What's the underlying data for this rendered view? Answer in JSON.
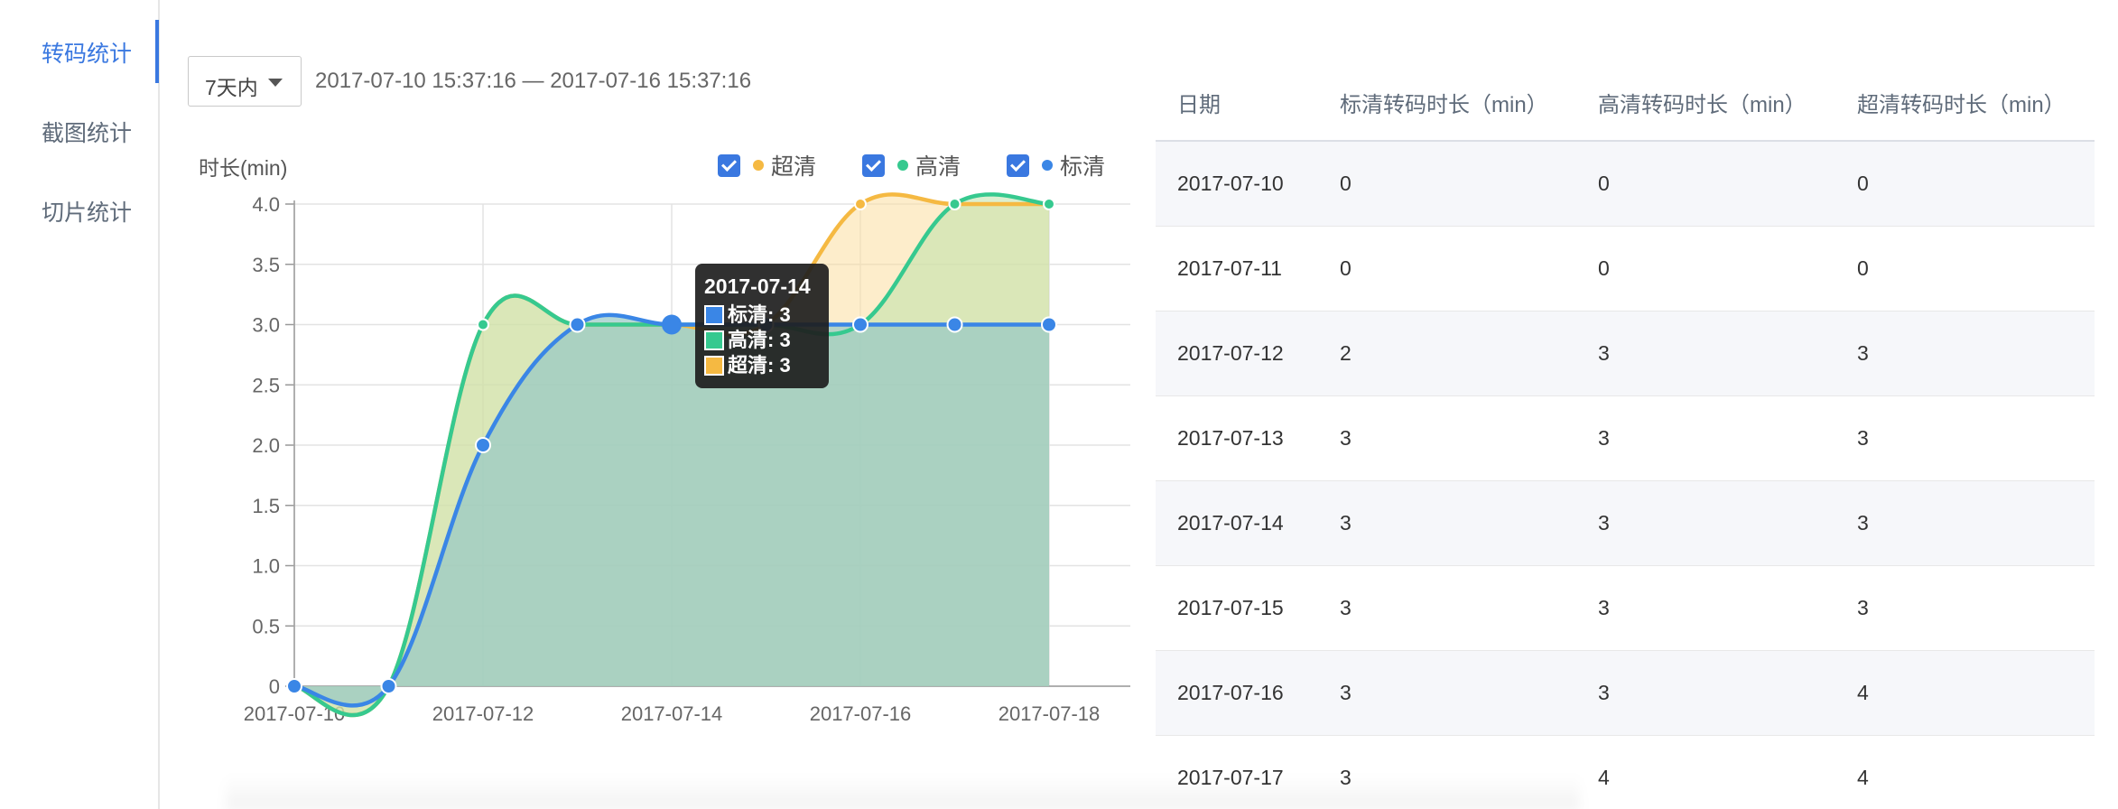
{
  "sidebar": {
    "items": [
      {
        "label": "转码统计",
        "active": true
      },
      {
        "label": "截图统计",
        "active": false
      },
      {
        "label": "切片统计",
        "active": false
      }
    ]
  },
  "toolbar": {
    "range_select": "7天内",
    "date_range": "2017-07-10 15:37:16 — 2017-07-16 15:37:16"
  },
  "legend": {
    "items": [
      {
        "label": "超清",
        "color": "#f5b942",
        "checked": true
      },
      {
        "label": "高清",
        "color": "#36c98f",
        "checked": true
      },
      {
        "label": "标清",
        "color": "#3a86e6",
        "checked": true
      }
    ]
  },
  "tooltip": {
    "title": "2017-07-14",
    "rows": [
      {
        "label": "标清: 3",
        "color": "#3a86e6"
      },
      {
        "label": "高清: 3",
        "color": "#36c98f"
      },
      {
        "label": "超清: 3",
        "color": "#f5b942"
      }
    ]
  },
  "chart_data": {
    "type": "area",
    "ylabel": "时长(min)",
    "ylim": [
      0,
      4
    ],
    "yticks": [
      "0",
      "0.5",
      "1.0",
      "1.5",
      "2.0",
      "2.5",
      "3.0",
      "3.5",
      "4.0"
    ],
    "xticks": [
      "2017-07-10",
      "2017-07-12",
      "2017-07-14",
      "2017-07-16",
      "2017-07-18"
    ],
    "grid": true,
    "legend_position": "top-right",
    "x": [
      "2017-07-10",
      "2017-07-11",
      "2017-07-12",
      "2017-07-13",
      "2017-07-14",
      "2017-07-15",
      "2017-07-16",
      "2017-07-17",
      "2017-07-18"
    ],
    "series": [
      {
        "name": "超清",
        "color": "#f5b942",
        "values": [
          0,
          0,
          3,
          3,
          3,
          3,
          4,
          4,
          4
        ]
      },
      {
        "name": "高清",
        "color": "#36c98f",
        "values": [
          0,
          0,
          3,
          3,
          3,
          3,
          3,
          4,
          4
        ]
      },
      {
        "name": "标清",
        "color": "#3a86e6",
        "values": [
          0,
          0,
          2,
          3,
          3,
          3,
          3,
          3,
          3
        ]
      }
    ]
  },
  "table": {
    "headers": [
      "日期",
      "标清转码时长（min）",
      "高清转码时长（min）",
      "超清转码时长（min）"
    ],
    "rows": [
      [
        "2017-07-10",
        "0",
        "0",
        "0"
      ],
      [
        "2017-07-11",
        "0",
        "0",
        "0"
      ],
      [
        "2017-07-12",
        "2",
        "3",
        "3"
      ],
      [
        "2017-07-13",
        "3",
        "3",
        "3"
      ],
      [
        "2017-07-14",
        "3",
        "3",
        "3"
      ],
      [
        "2017-07-15",
        "3",
        "3",
        "3"
      ],
      [
        "2017-07-16",
        "3",
        "3",
        "4"
      ],
      [
        "2017-07-17",
        "3",
        "4",
        "4"
      ]
    ]
  }
}
